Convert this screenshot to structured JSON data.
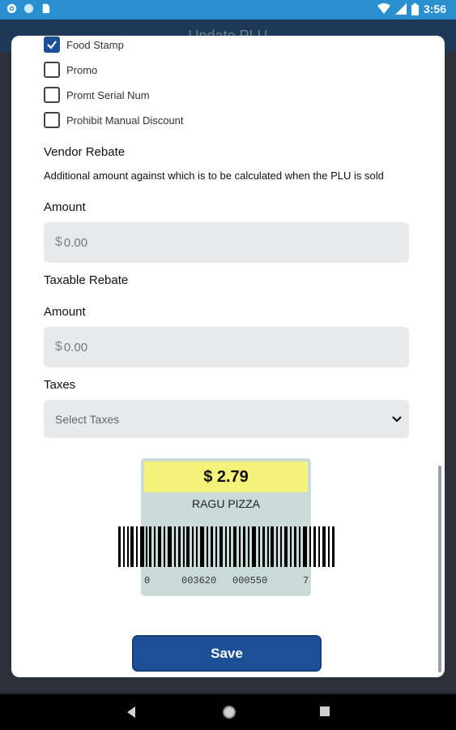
{
  "status_bar": {
    "time": "3:56",
    "icons": [
      "gear-icon",
      "circle-icon",
      "sim-icon",
      "wifi-icon",
      "signal-icon",
      "battery-icon"
    ]
  },
  "app_bar": {
    "title": "Update PLU",
    "back_icon": "back-arrow-icon"
  },
  "dialog": {
    "checkboxes": [
      {
        "label": "Food Stamp",
        "checked": true
      },
      {
        "label": "Promo",
        "checked": false
      },
      {
        "label": "Promt Serial Num",
        "checked": false
      },
      {
        "label": "Prohibit Manual Discount",
        "checked": false
      }
    ],
    "vendor_rebate": {
      "heading": "Vendor Rebate",
      "description": "Additional amount against which is to be calculated when the PLU is sold",
      "amount_label": "Amount",
      "currency": "$",
      "amount_placeholder": "0.00"
    },
    "taxable_rebate": {
      "heading": "Taxable Rebate",
      "amount_label": "Amount",
      "currency": "$",
      "amount_placeholder": "0.00"
    },
    "taxes": {
      "label": "Taxes",
      "placeholder": "Select Taxes"
    },
    "price_tag": {
      "price": "$ 2.79",
      "name": "RAGU PIZZA",
      "barcode_digits": [
        "0",
        "003620",
        "000550",
        "7"
      ]
    },
    "save_label": "Save"
  },
  "colors": {
    "accent": "#1c4f96",
    "status_bar": "#2a8fcf",
    "price_highlight": "#f4f27a",
    "tag_bg": "#c9dad8"
  }
}
